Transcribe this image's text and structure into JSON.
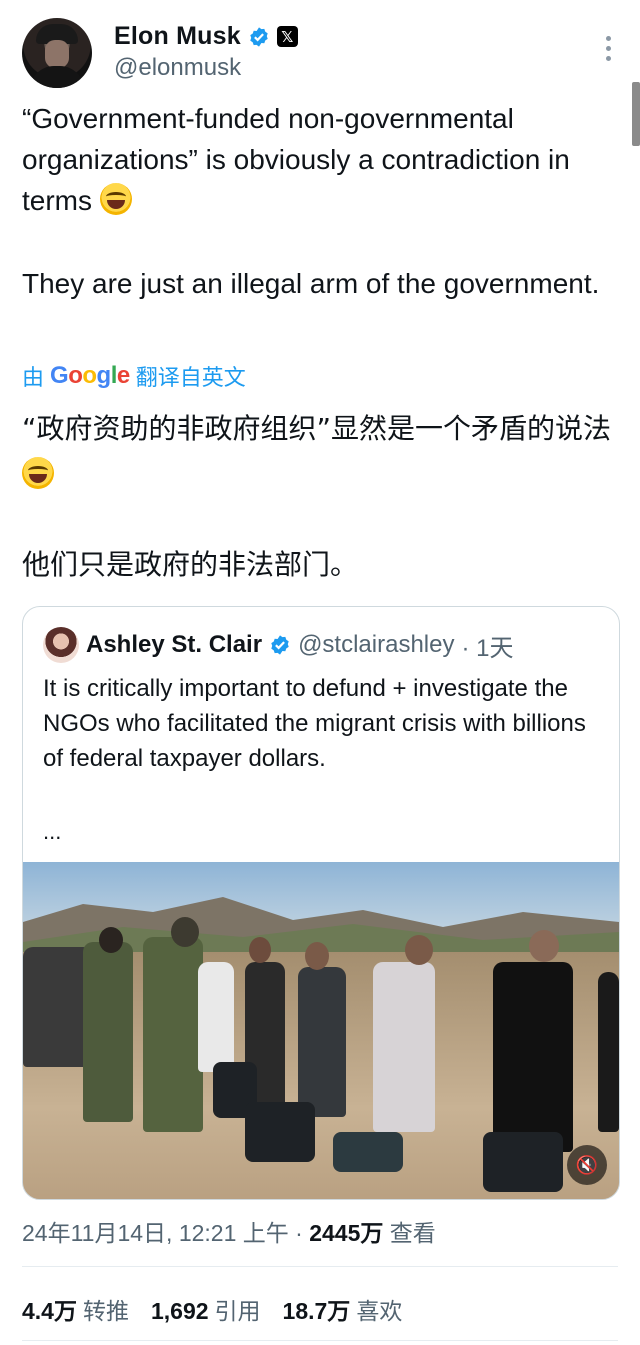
{
  "author": {
    "name": "Elon Musk",
    "handle": "@elonmusk",
    "x_badge": "𝕏"
  },
  "tweet": {
    "line1": "“Government-funded non-governmental organizations” is obviously a contradiction in terms",
    "line2": "They are just an illegal arm of the government."
  },
  "translation": {
    "prefix": "由",
    "provider": "Google",
    "suffix": "翻译自英文",
    "para1": "“政府资助的非政府组织”显然是一个矛盾的说法",
    "para2": "他们只是政府的非法部门。"
  },
  "quote": {
    "name": "Ashley St. Clair",
    "handle": "@stclairashley",
    "time": "· 1天",
    "text": "It is critically important to defund + investigate the NGOs who facilitated the migrant crisis with billions of federal taxpayer dollars.",
    "ellipsis": "...",
    "mute_icon": "speaker-muted-icon"
  },
  "meta": {
    "datetime": "24年11月14日, 12:21 上午 · ",
    "views": "2445万",
    "views_label": " 查看"
  },
  "stats": {
    "retweets": "4.4万",
    "retweets_label": "转推",
    "quotes": "1,692",
    "quotes_label": "引用",
    "likes": "18.7万",
    "likes_label": "喜欢"
  },
  "colors": {
    "accent": "#1d9bf0",
    "text": "#0f1419",
    "secondary": "#536471",
    "border": "#cfd9de"
  }
}
